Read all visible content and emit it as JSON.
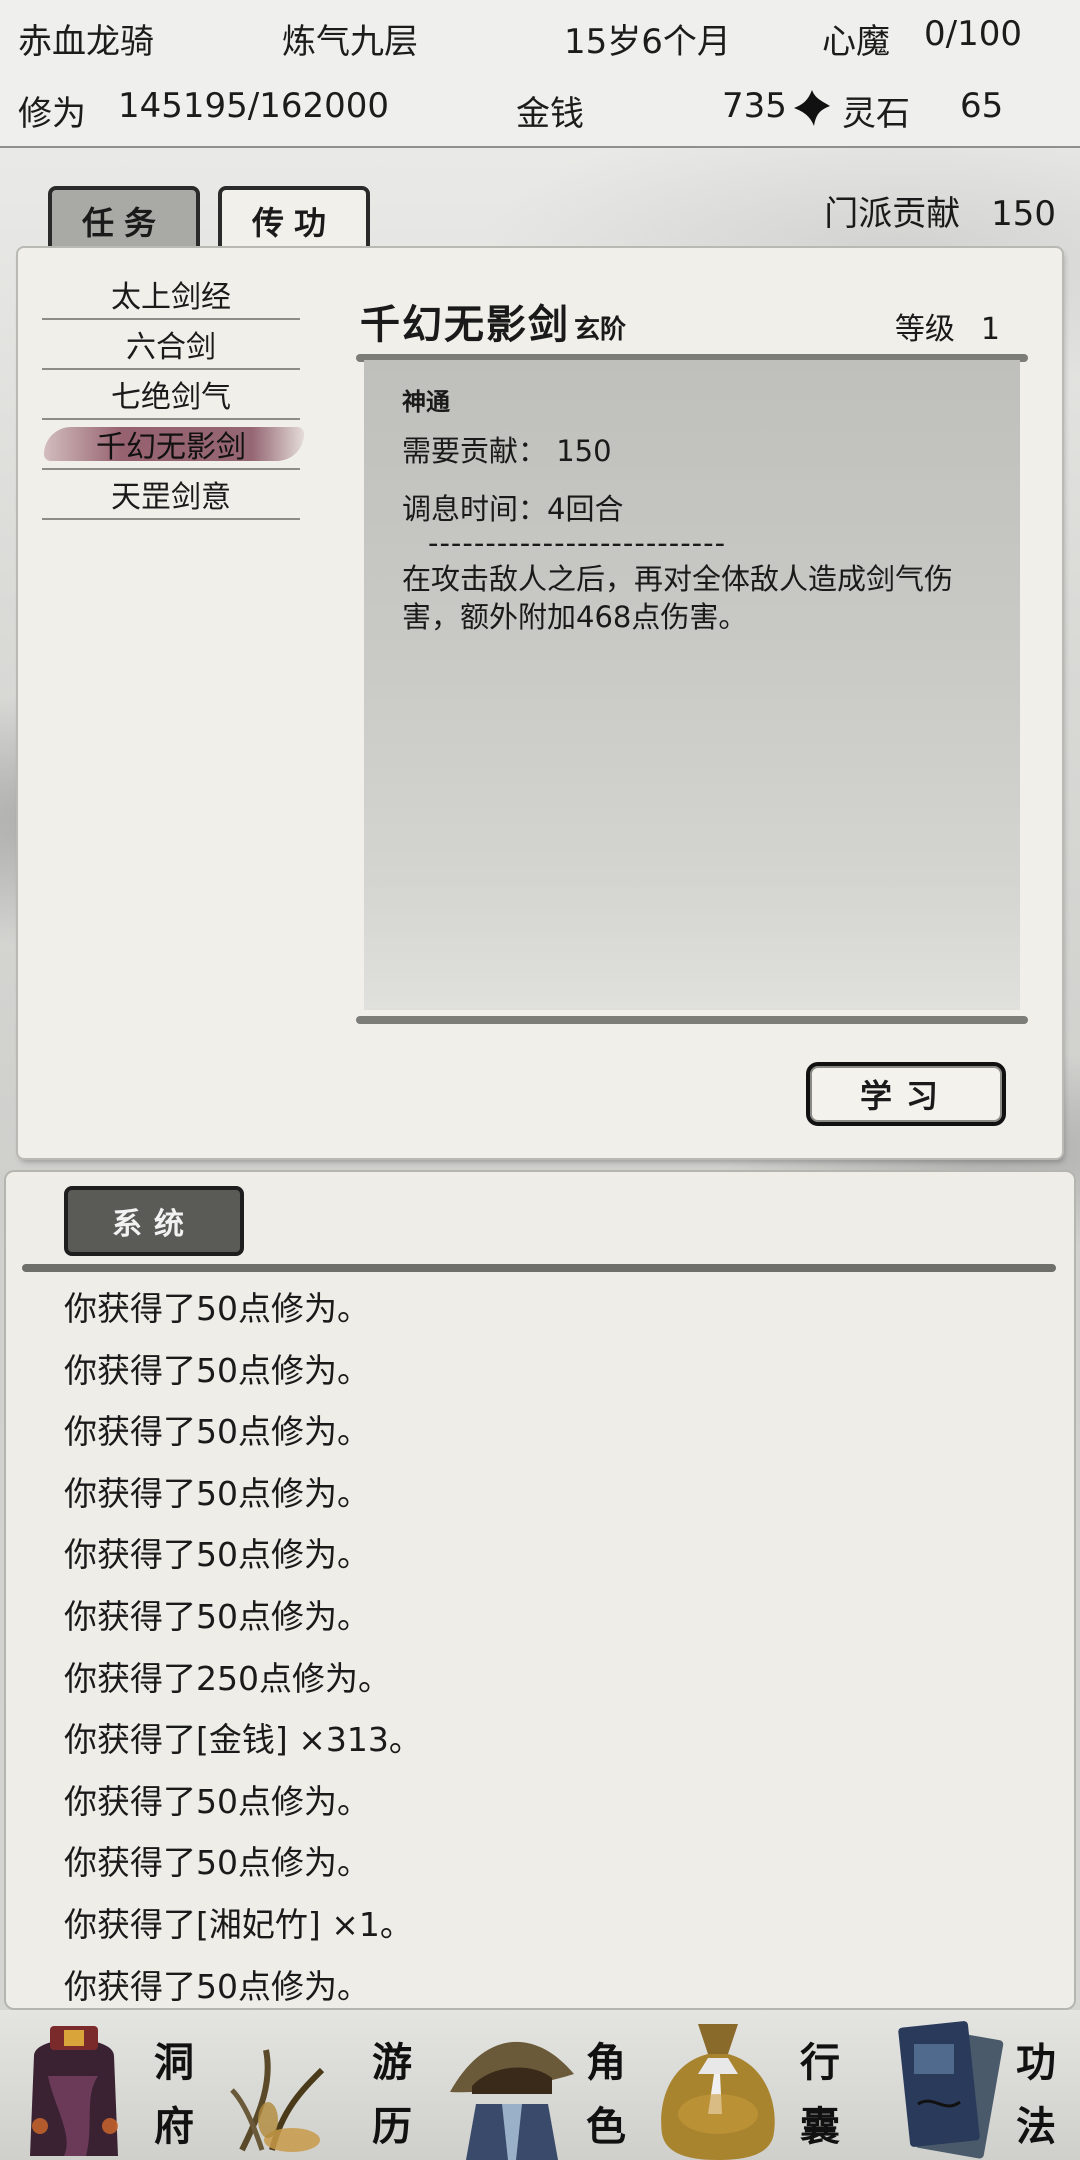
{
  "status": {
    "name": "赤血龙骑",
    "realm": "炼气九层",
    "age": "15岁6个月",
    "demon_label": "心魔",
    "demon_value": "0/100",
    "cultivation_label": "修为",
    "cultivation_value": "145195/162000",
    "money_label": "金钱",
    "money_value": "735",
    "spirit_label": "灵石",
    "spirit_value": "65"
  },
  "tabs": [
    {
      "label": "任务"
    },
    {
      "label": "传功"
    }
  ],
  "contribution": {
    "label": "门派贡献",
    "value": "150"
  },
  "skills": [
    {
      "name": "太上剑经"
    },
    {
      "name": "六合剑"
    },
    {
      "name": "七绝剑气"
    },
    {
      "name": "千幻无影剑"
    },
    {
      "name": "天罡剑意"
    }
  ],
  "selected_skill": {
    "name": "千幻无影剑",
    "tier": "玄阶",
    "level_label": "等级",
    "level_value": "1",
    "category": "神通",
    "cost": "需要贡献： 150",
    "cooldown": "调息时间：4回合",
    "separator": "--------------------------",
    "description": "在攻击敌人之后，再对全体敌人造成剑气伤害，额外附加468点伤害。",
    "learn_label": "学习"
  },
  "log": {
    "tab_label": "系统",
    "lines": [
      "你获得了50点修为。",
      "你获得了50点修为。",
      "你获得了50点修为。",
      "你获得了50点修为。",
      "你获得了50点修为。",
      "你获得了50点修为。",
      "你获得了250点修为。",
      "你获得了[金钱] ×313。",
      "你获得了50点修为。",
      "你获得了50点修为。",
      "你获得了[湘妃竹] ×1。",
      "你获得了50点修为。"
    ]
  },
  "nav": [
    {
      "label_top": "洞",
      "label_bottom": "府",
      "icon": "cave-dwelling-icon"
    },
    {
      "label_top": "游",
      "label_bottom": "历",
      "icon": "travel-icon"
    },
    {
      "label_top": "角",
      "label_bottom": "色",
      "icon": "character-icon"
    },
    {
      "label_top": "行",
      "label_bottom": "囊",
      "icon": "bag-icon"
    },
    {
      "label_top": "功",
      "label_bottom": "法",
      "icon": "scripture-icon"
    }
  ]
}
